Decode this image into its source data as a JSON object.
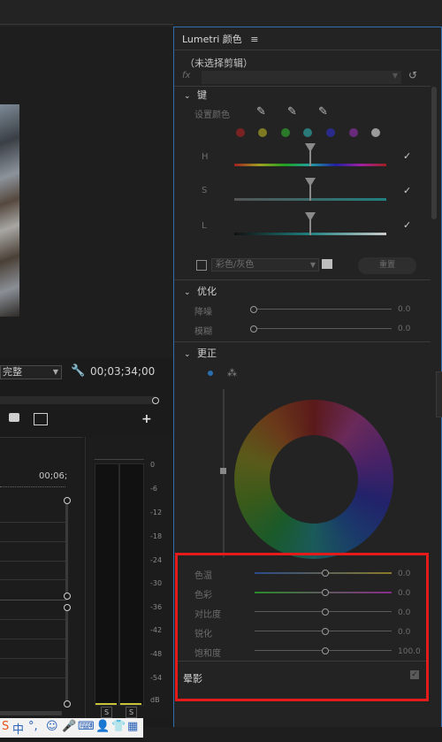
{
  "program_monitor": {
    "quality_select": "完整",
    "timecode": "00;03;34;00"
  },
  "timeline": {
    "ruler_time": "00;06;"
  },
  "audio_meters": {
    "scale": [
      "0",
      "-6",
      "-12",
      "-18",
      "-24",
      "-30",
      "-36",
      "-42",
      "-48",
      "-54",
      "dB"
    ],
    "solo_buttons": [
      "S",
      "S"
    ]
  },
  "lumetri": {
    "title": "Lumetri 颜色",
    "clip": "（未选择剪辑）",
    "fx_label": "fx",
    "hsl_section": {
      "header": "键",
      "set_color_label": "设置颜色",
      "swatches": [
        "#7a2222",
        "#7d7a22",
        "#2a7a2a",
        "#2a7a7a",
        "#2a2a8a",
        "#6a2a7a",
        "#9a9a9a"
      ],
      "hsl_rows": [
        {
          "label": "H",
          "checked": true
        },
        {
          "label": "S",
          "checked": true
        },
        {
          "label": "L",
          "checked": true
        }
      ],
      "mask_dropdown": "彩色/灰色",
      "reset_button": "重置"
    },
    "refine_section": {
      "header": "优化",
      "sliders": [
        {
          "label": "降噪",
          "value": "0.0"
        },
        {
          "label": "模糊",
          "value": "0.0"
        }
      ]
    },
    "correction_section": {
      "header": "更正"
    },
    "adjust_sliders": [
      {
        "label": "色温",
        "value": "0.0"
      },
      {
        "label": "色彩",
        "value": "0.0"
      },
      {
        "label": "对比度",
        "value": "0.0"
      },
      {
        "label": "锐化",
        "value": "0.0"
      },
      {
        "label": "饱和度",
        "value": "100.0"
      }
    ],
    "vignette": {
      "label": "晕影",
      "checked": true
    }
  },
  "taskbar": {
    "ime_label": "中"
  }
}
